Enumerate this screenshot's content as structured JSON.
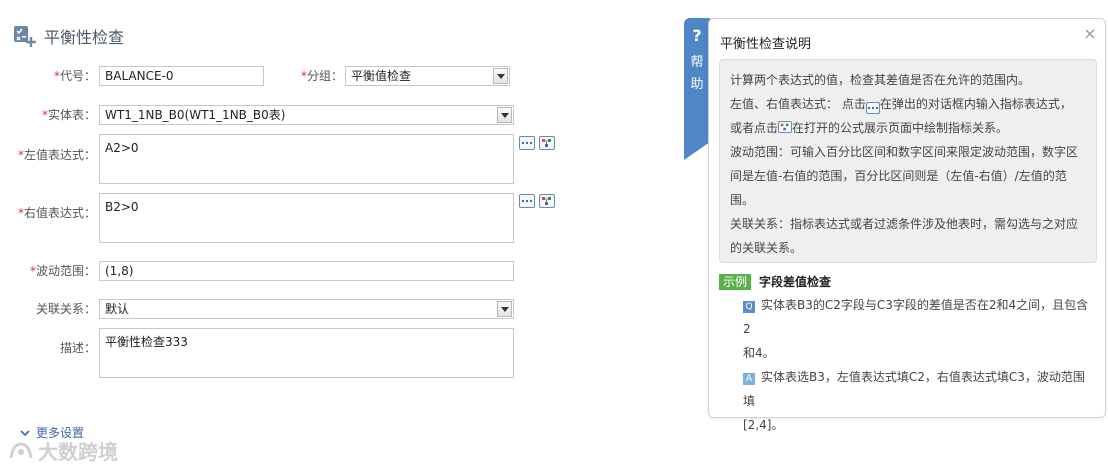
{
  "header": {
    "title": "平衡性检查",
    "icon": "rule-add-icon"
  },
  "form": {
    "code": {
      "label": "代号：",
      "value": "BALANCE-0"
    },
    "group": {
      "label": "分组：",
      "value": "平衡值检查"
    },
    "entity_table": {
      "label": "实体表：",
      "value": "WT1_1NB_B0(WT1_1NB_B0表)"
    },
    "left_expr": {
      "label": "左值表达式：",
      "value": "A2>0"
    },
    "right_expr": {
      "label": "右值表达式：",
      "value": "B2>0"
    },
    "range": {
      "label": "波动范围：",
      "value": "(1,8)"
    },
    "relation": {
      "label": "关联关系：",
      "value": "默认"
    },
    "description": {
      "label": "描述：",
      "value": "平衡性检查333"
    },
    "required_mark": "*"
  },
  "more_settings": "更多设置",
  "watermark": "大数跨境",
  "help": {
    "tab_q": "?",
    "tab_text_1": "帮",
    "tab_text_2": "助",
    "title": "平衡性检查说明",
    "close": "×",
    "p1": "计算两个表达式的值，检查其差值是否在允许的范围内。",
    "p2a": "左值、右值表达式：  点击",
    "p2b": "在弹出的对话框内输入指标表达式，",
    "p2c": "或者点击",
    "p2d": "在打开的公式展示页面中绘制指标关系。",
    "p3a": "波动范围：可输入百分比区间和数字区间来限定波动范围，数字区",
    "p3b": "间是左值-右值的范围，百分比区间则是（左值-右值）/左值的范",
    "p3c": "围。",
    "p4a": "关联关系：指标表达式或者过滤条件涉及他表时，需勾选与之对应",
    "p4b": "的关联关系。",
    "example_badge": "示例",
    "example_title": "字段差值检查",
    "q_mark": "Q",
    "a_mark": "A",
    "q_text_1": "实体表B3的C2字段与C3字段的差值是否在2和4之间，且包含2",
    "q_text_2": "和4。",
    "a_text_1": "实体表选B3，左值表达式填C2，右值表达式填C3，波动范围填",
    "a_text_2": "[2,4]。"
  },
  "colors": {
    "accent": "#4f86c6",
    "required": "#e03030",
    "example_badge": "#5ab14a",
    "link": "#3a6aa8"
  }
}
